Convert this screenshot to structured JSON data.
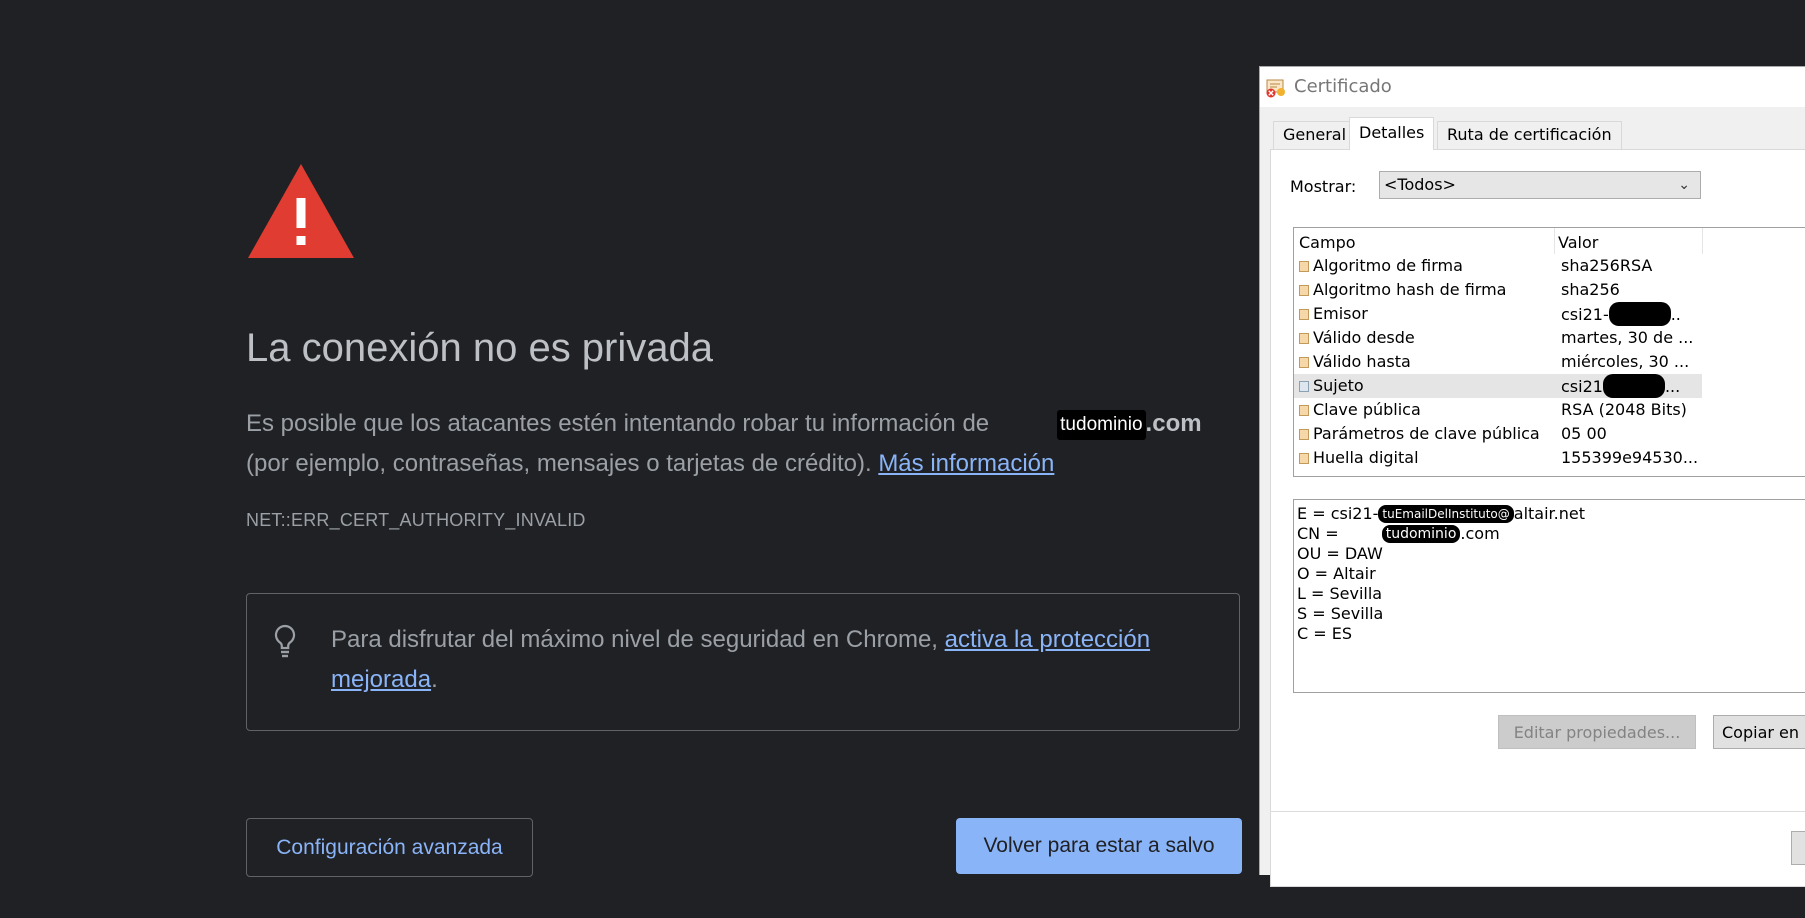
{
  "page": {
    "title": "La conexión no es privada",
    "body_line1_prefix": "Es posible que los atacantes estén intentando robar tu información de",
    "body_line1_redaction": "tudominio",
    "body_line1_suffix": ".com",
    "body_line2_prefix": "(por ejemplo, contraseñas, mensajes o tarjetas de crédito).",
    "more_info_link": "Más información",
    "error_code": "NET::ERR_CERT_AUTHORITY_INVALID",
    "tip_prefix": "Para disfrutar del máximo nivel de seguridad en Chrome, ",
    "tip_link": "activa la protección mejorada",
    "tip_suffix": ".",
    "advanced_button": "Configuración avanzada",
    "back_button": "Volver para estar a salvo",
    "icon": "warning-triangle-icon",
    "colors": {
      "background": "#202124",
      "warning_red": "#e03c31",
      "link_blue": "#8ab4f8"
    }
  },
  "certificate_dialog": {
    "title": "Certificado",
    "tabs": [
      "General",
      "Detalles",
      "Ruta de certificación"
    ],
    "active_tab": "Detalles",
    "show_label": "Mostrar:",
    "show_value": "<Todos>",
    "columns": {
      "field": "Campo",
      "value": "Valor"
    },
    "rows": [
      {
        "field": "Algoritmo de firma",
        "value": "sha256RSA"
      },
      {
        "field": "Algoritmo hash de firma",
        "value": "sha256"
      },
      {
        "field": "Emisor",
        "value_prefix": "csi21-",
        "value_suffix": ".."
      },
      {
        "field": "Válido desde",
        "value": "martes, 30 de ..."
      },
      {
        "field": "Válido hasta",
        "value": "miércoles, 30 ..."
      },
      {
        "field": "Sujeto",
        "value_prefix": "csi21",
        "value_suffix": "...",
        "selected": true
      },
      {
        "field": "Clave pública",
        "value": "RSA (2048 Bits)"
      },
      {
        "field": "Parámetros de clave pública",
        "value": "05 00"
      },
      {
        "field": "Huella digital",
        "value": "155399e94530..."
      }
    ],
    "detail": {
      "e_prefix": "E = csi21-",
      "e_redaction": "tuEmailDelInstituto@",
      "e_suffix": "altair.net",
      "cn_prefix": "CN = ",
      "cn_redaction": "tudominio",
      "cn_suffix": ".com",
      "lines": [
        "OU = DAW",
        "O = Altair",
        "L = Sevilla",
        "S = Sevilla",
        "C = ES"
      ]
    },
    "edit_button": "Editar propiedades...",
    "copy_button": "Copiar en"
  }
}
